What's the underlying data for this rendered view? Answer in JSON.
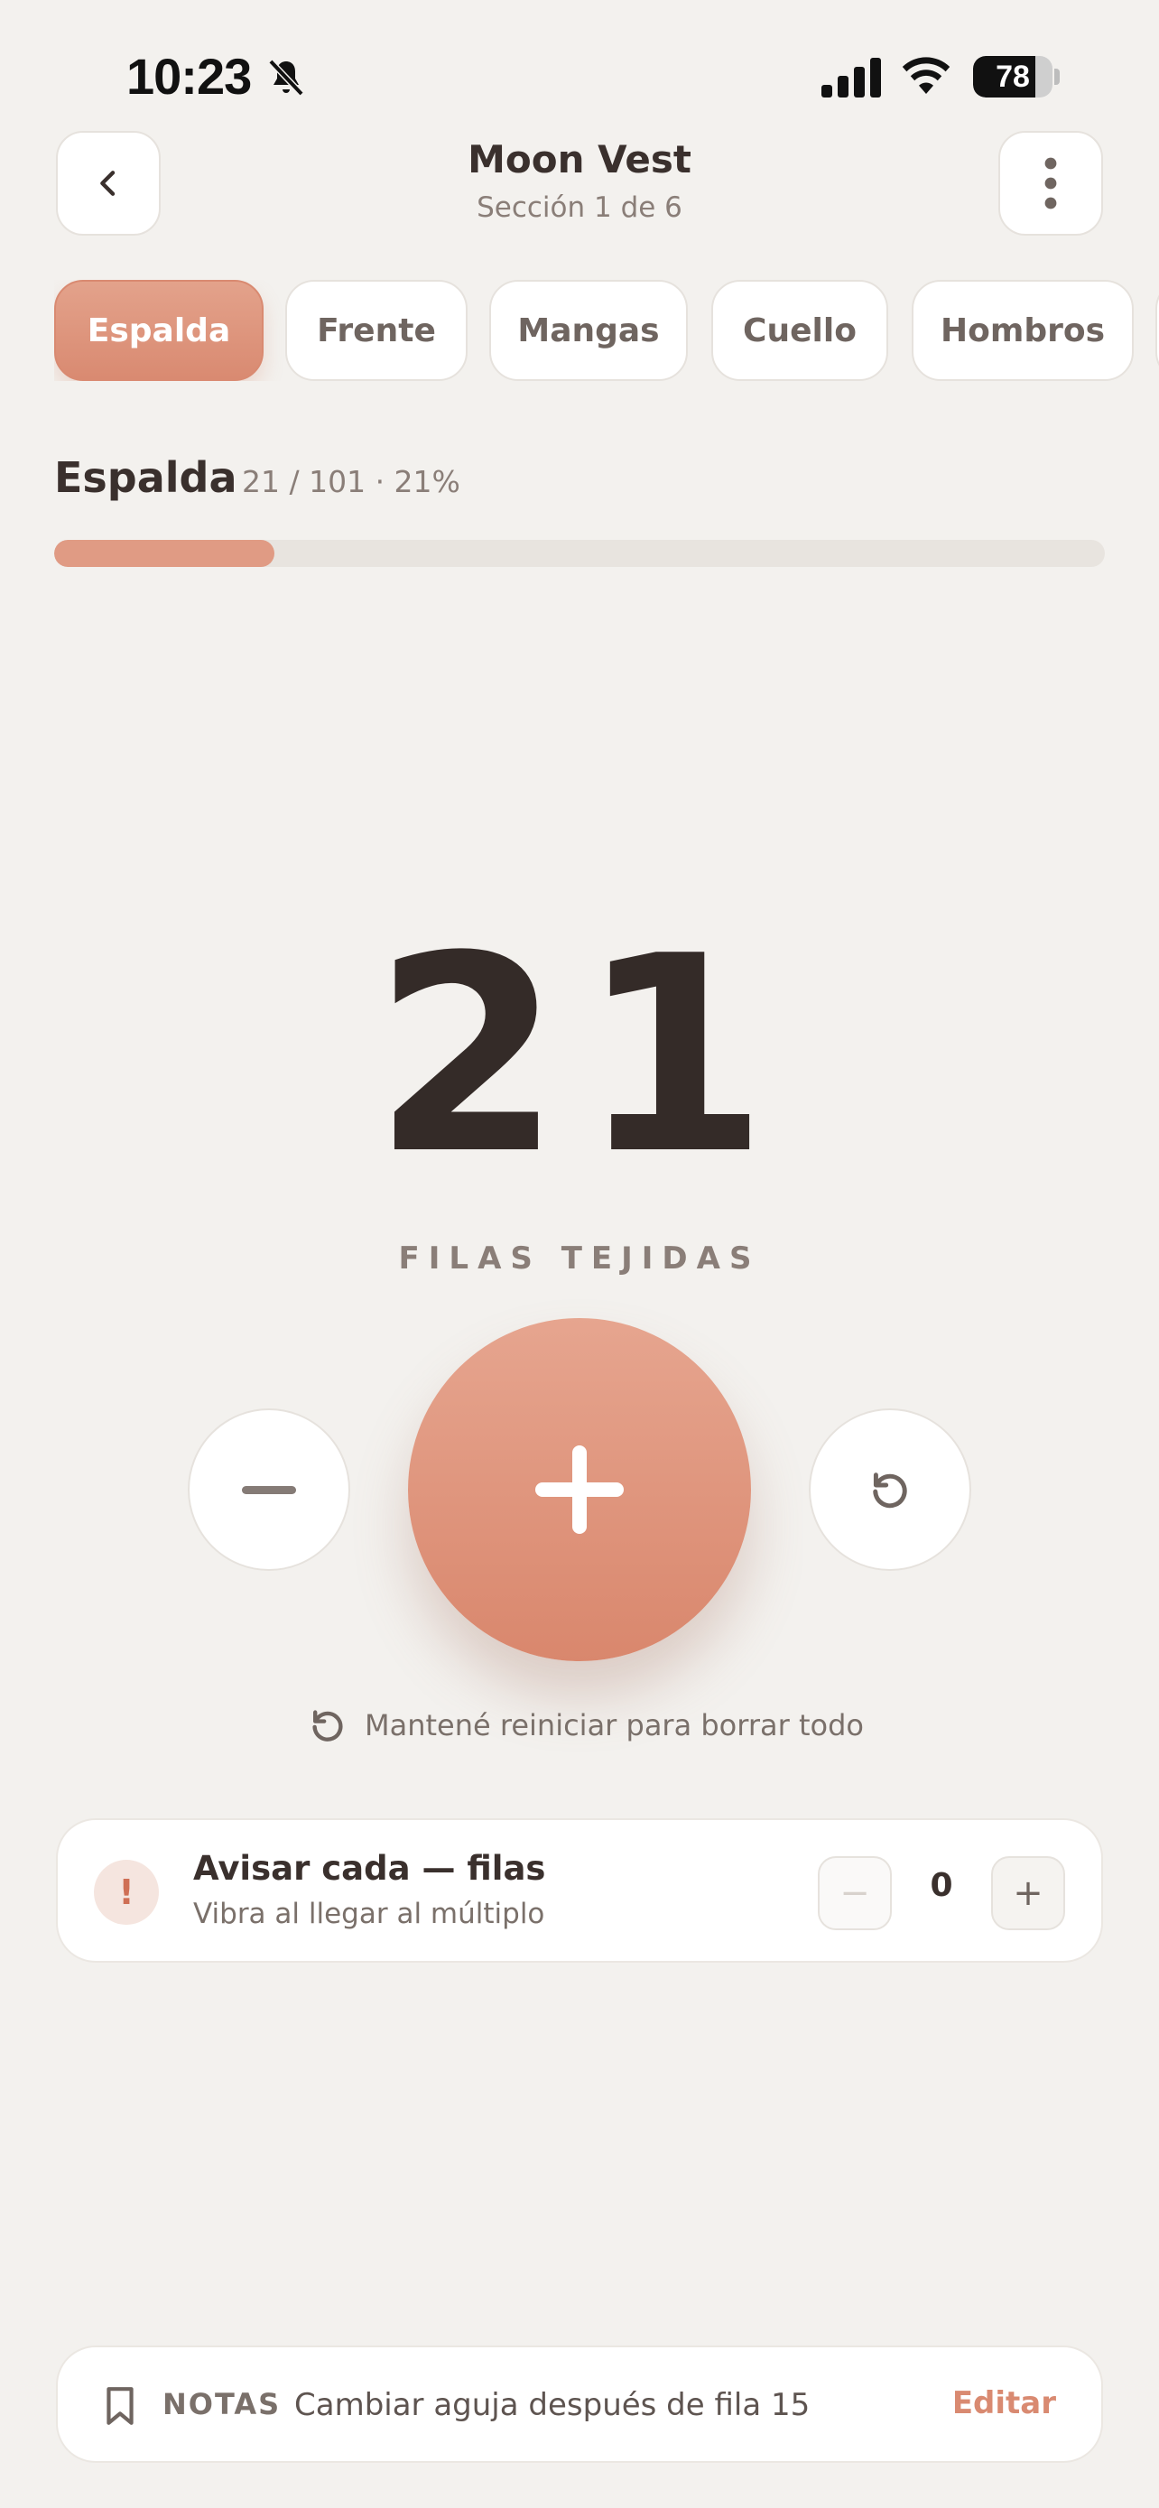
{
  "status_bar": {
    "time": "10:23",
    "battery_level": "78",
    "battery_fraction": 0.78,
    "icons": [
      "bell-slash-icon",
      "cellular-signal-icon",
      "wifi-icon",
      "battery-icon"
    ]
  },
  "header": {
    "title": "Moon Vest",
    "subtitle": "Sección 1 de 6",
    "back_icon": "chevron-left-icon",
    "menu_icon": "more-vertical-icon"
  },
  "tabs": [
    {
      "label": "Espalda",
      "active": true
    },
    {
      "label": "Frente",
      "active": false
    },
    {
      "label": "Mangas",
      "active": false
    },
    {
      "label": "Cuello",
      "active": false
    },
    {
      "label": "Hombros",
      "active": false
    }
  ],
  "section": {
    "name": "Espalda",
    "stats": "21 / 101 · 21%",
    "progress_fraction": 0.21
  },
  "counter": {
    "value": "21",
    "label": "FILAS TEJIDAS"
  },
  "controls": {
    "decrement_icon": "minus-icon",
    "increment_icon": "plus-icon",
    "reset_icon": "reset-icon",
    "hint": "Mantené reiniciar para borrar todo"
  },
  "alert": {
    "icon_glyph": "!",
    "title": "Avisar cada — filas",
    "subtitle": "Vibra al llegar al múltiplo",
    "value": "0",
    "minus_glyph": "−",
    "plus_glyph": "+"
  },
  "notes": {
    "label": "NOTAS",
    "text": "Cambiar aguja después de fila 15",
    "edit_label": "Editar"
  },
  "colors": {
    "accent": "#d98a71",
    "background": "#f3f1ee",
    "text": "#342b28"
  }
}
